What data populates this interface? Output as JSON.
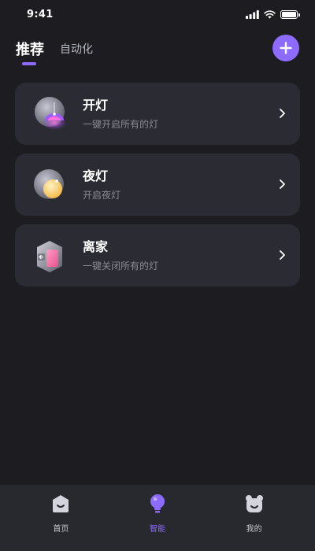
{
  "status_bar": {
    "time": "9:41",
    "icons": [
      "signal-icon",
      "wifi-icon",
      "battery-icon"
    ]
  },
  "header": {
    "tabs": [
      {
        "label": "推荐",
        "active": true
      },
      {
        "label": "自动化",
        "active": false
      }
    ],
    "add_button_icon": "plus-icon"
  },
  "scenes": [
    {
      "title": "开灯",
      "subtitle": "一键开启所有的灯",
      "icon": "ceiling-lamp-icon"
    },
    {
      "title": "夜灯",
      "subtitle": "开启夜灯",
      "icon": "moon-light-icon"
    },
    {
      "title": "离家",
      "subtitle": "一键关闭所有的灯",
      "icon": "leave-home-door-icon"
    }
  ],
  "bottom_nav": {
    "items": [
      {
        "label": "首页",
        "icon": "home-icon",
        "active": false
      },
      {
        "label": "智能",
        "icon": "bulb-icon",
        "active": true
      },
      {
        "label": "我的",
        "icon": "profile-icon",
        "active": false
      }
    ]
  },
  "colors": {
    "background": "#1c1c21",
    "card": "#2b2b33",
    "accent": "#8e6bff",
    "nav_bar": "#28282f"
  }
}
